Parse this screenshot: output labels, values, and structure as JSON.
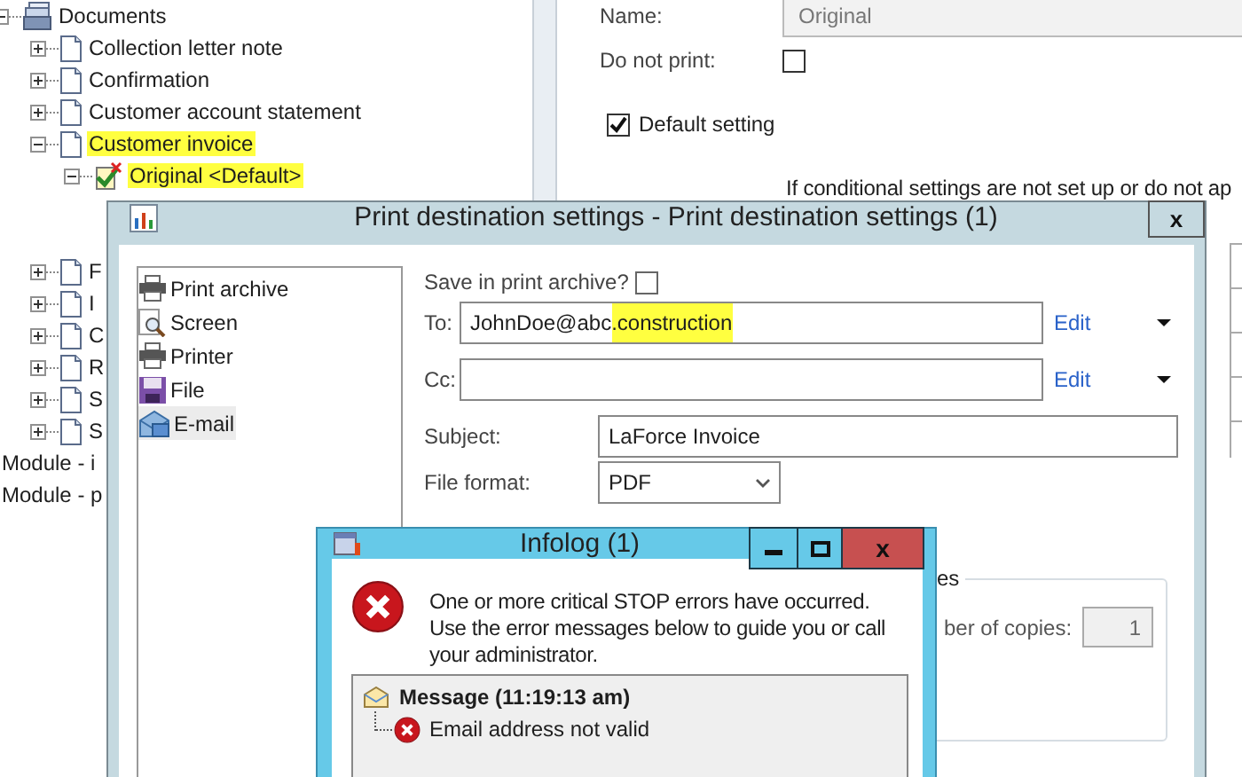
{
  "tree": [
    {
      "label": "Documents",
      "kind": "documents",
      "expanded": true,
      "children": [
        {
          "label": "Collection letter note",
          "kind": "document",
          "expanded": false
        },
        {
          "label": "Confirmation",
          "kind": "document",
          "expanded": false
        },
        {
          "label": "Customer account statement",
          "kind": "document",
          "expanded": false
        },
        {
          "label": "Customer invoice",
          "kind": "document",
          "expanded": true,
          "highlighted": true,
          "children": [
            {
              "label": "Original <Default>",
              "kind": "setting",
              "expanded": true,
              "highlighted": true
            }
          ]
        },
        {
          "label": "F",
          "kind": "document",
          "expanded": false
        },
        {
          "label": "I",
          "kind": "document",
          "expanded": false
        },
        {
          "label": "C",
          "kind": "document",
          "expanded": false
        },
        {
          "label": "R",
          "kind": "document",
          "expanded": false
        },
        {
          "label": "S",
          "kind": "document",
          "expanded": false
        },
        {
          "label": "S",
          "kind": "document",
          "expanded": false
        }
      ]
    },
    {
      "label": "Module - i",
      "kind": "module"
    },
    {
      "label": "Module - p",
      "kind": "module"
    }
  ],
  "properties": {
    "name_label": "Name:",
    "name_value": "Original",
    "do_not_print_label": "Do not print:",
    "do_not_print_checked": false,
    "default_setting_label": "Default setting",
    "default_setting_checked": true,
    "note": "If conditional settings are not set up or do not ap"
  },
  "print_dialog": {
    "title": "Print destination settings - Print destination settings (1)",
    "close": "x",
    "destinations": [
      {
        "label": "Print archive",
        "kind": "archive",
        "selected": false
      },
      {
        "label": "Screen",
        "kind": "screen",
        "selected": false
      },
      {
        "label": "Printer",
        "kind": "printer",
        "selected": false
      },
      {
        "label": "File",
        "kind": "file",
        "selected": false
      },
      {
        "label": "E-mail",
        "kind": "email",
        "selected": true
      }
    ],
    "save_in_archive": {
      "label": "Save in print archive?",
      "checked": false
    },
    "to": {
      "label": "To:",
      "value_parts": [
        {
          "text": "JohnDoe@abc",
          "highlighted": false
        },
        {
          "text": ".construction",
          "highlighted": true
        }
      ],
      "link": "Edit"
    },
    "cc": {
      "label": "Cc:",
      "link": "Edit"
    },
    "subject": {
      "label": "Subject:",
      "value": "LaForce Invoice"
    },
    "file_format": {
      "label": "File format:",
      "value": "PDF"
    },
    "copies": {
      "group_title": "es",
      "label": "ber of copies:",
      "value": "1"
    }
  },
  "infolog": {
    "title": "Infolog (1)",
    "close": "x",
    "message": "One or more critical STOP errors have occurred. Use the error messages below to guide you or call your administrator.",
    "log_header": "Message (11:19:13 am)",
    "entries": [
      "Email address not valid"
    ]
  }
}
